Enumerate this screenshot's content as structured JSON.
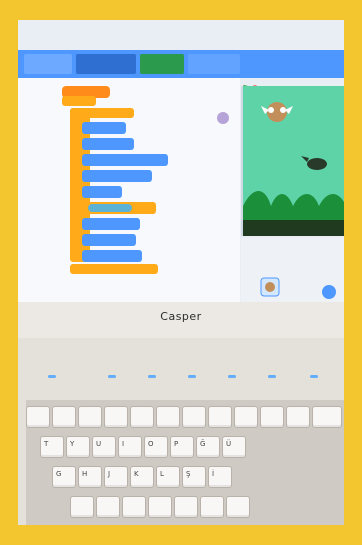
{
  "laptop": {
    "brand_label": "Casper"
  },
  "colors": {
    "frame_border": "#f3c62f",
    "scratch_topbar": "#4d97ff",
    "stage_background": "#5fd3a8",
    "keyboard_backlight": "#4da3ff"
  },
  "scratch_ui": {
    "topbar_tabs": [
      "",
      "",
      "",
      ""
    ],
    "code_blocks_visible": true,
    "stage_visible": true
  },
  "keyboard": {
    "row_letters": [
      "T",
      "Y",
      "U",
      "I",
      "O",
      "P",
      "Ğ",
      "Ü"
    ],
    "row2_letters": [
      "G",
      "H",
      "J",
      "K",
      "L",
      "Ş",
      "İ"
    ]
  }
}
